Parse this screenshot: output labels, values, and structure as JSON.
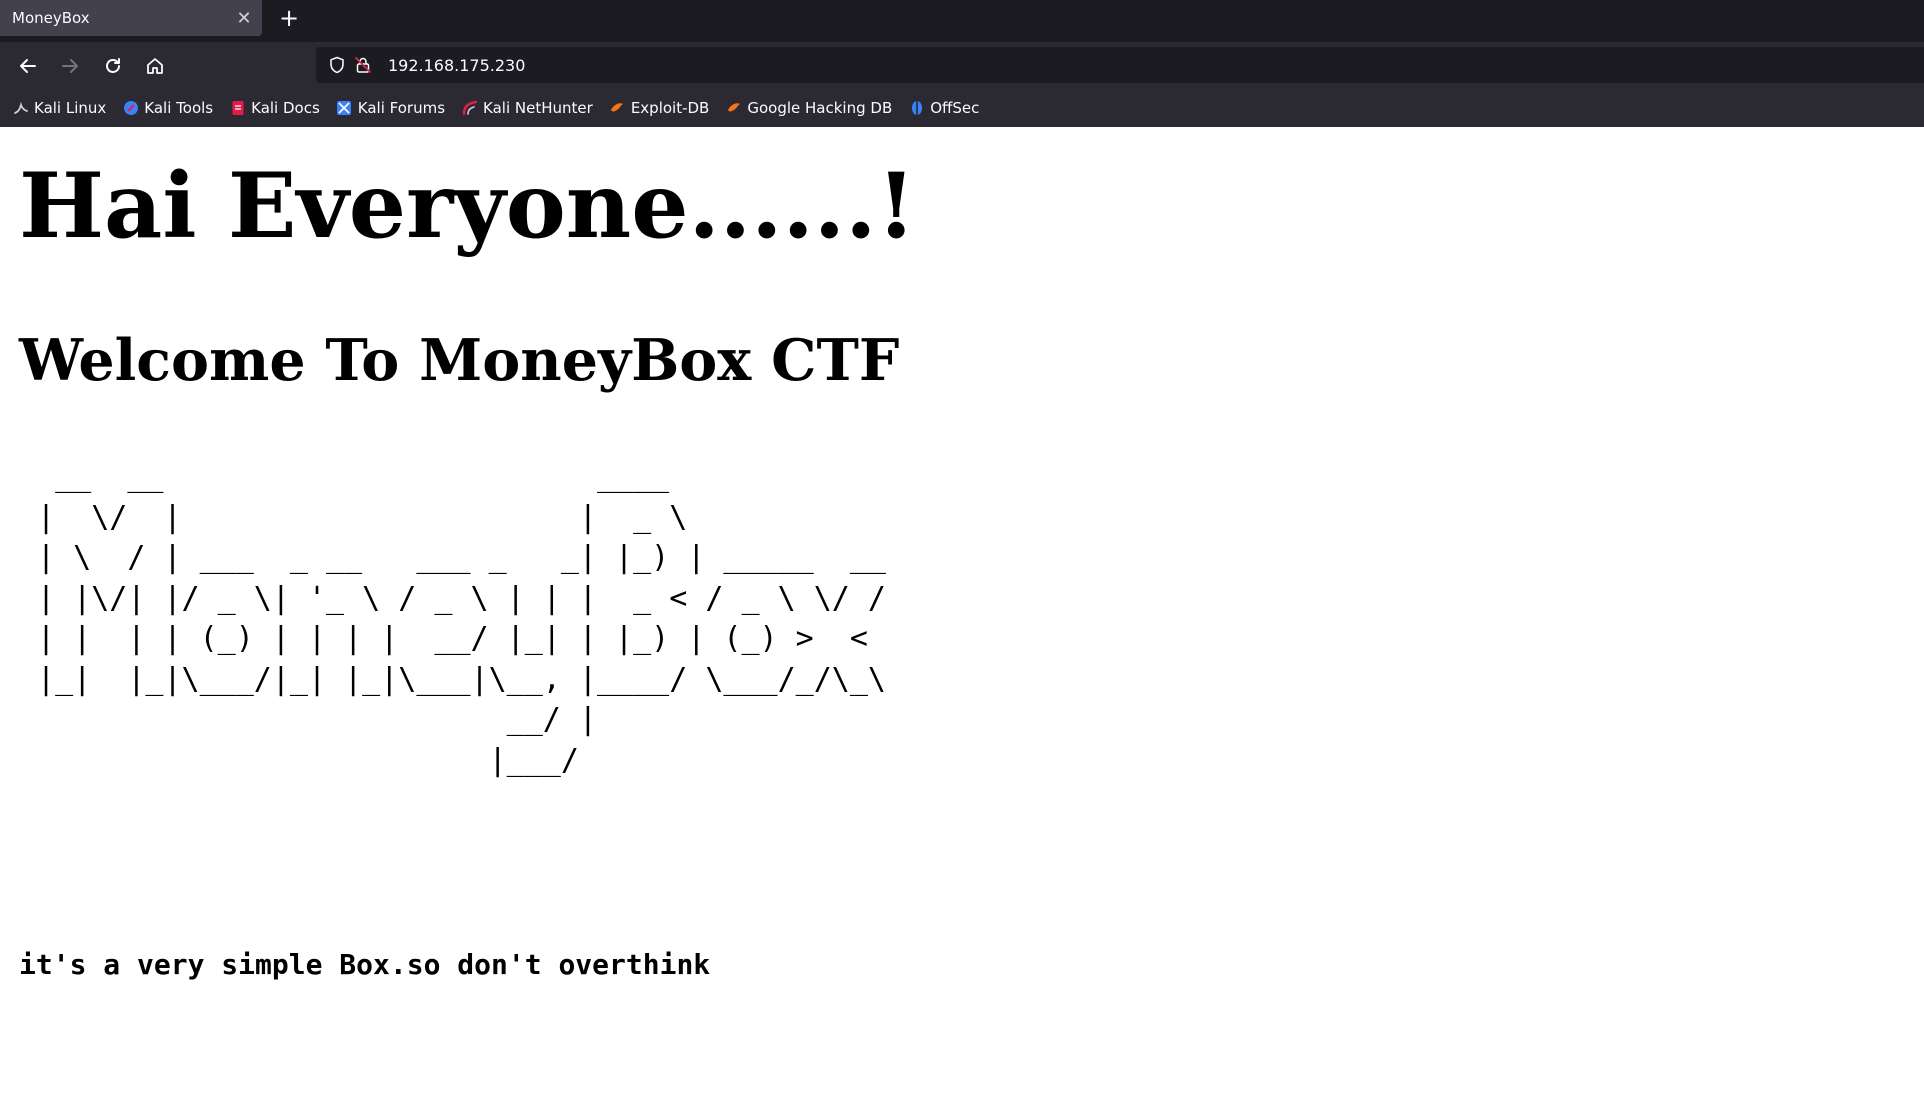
{
  "browser": {
    "tab": {
      "title": "MoneyBox",
      "close_symbol": "✕",
      "new_tab_symbol": "+"
    },
    "url": "192.168.175.230",
    "bookmarks": [
      {
        "label": "Kali Linux",
        "icon": "kali-dragon-icon",
        "color": "#cfcfd6"
      },
      {
        "label": "Kali Tools",
        "icon": "kali-tools-icon",
        "color": "#3b82f6"
      },
      {
        "label": "Kali Docs",
        "icon": "kali-docs-icon",
        "color": "#e11d48"
      },
      {
        "label": "Kali Forums",
        "icon": "kali-forums-icon",
        "color": "#3b82f6"
      },
      {
        "label": "Kali NetHunter",
        "icon": "kali-nethunter-icon",
        "color": "#e11d48"
      },
      {
        "label": "Exploit-DB",
        "icon": "exploit-db-icon",
        "color": "#f97316"
      },
      {
        "label": "Google Hacking DB",
        "icon": "google-hacking-db-icon",
        "color": "#f97316"
      },
      {
        "label": "OffSec",
        "icon": "offsec-icon",
        "color": "#3b82f6"
      }
    ]
  },
  "page": {
    "heading1": "Hai Everyone......!",
    "heading2": "Welcome To MoneyBox CTF",
    "ascii_art": "  __  __                        ____            \n |  \\/  |                      |  _ \\           \n | \\  / | ___  _ __   ___ _   _| |_) | _____  __\n | |\\/| |/ _ \\| '_ \\ / _ \\ | | |  _ < / _ \\ \\/ /\n | |  | | (_) | | | |  __/ |_| | |_) | (_) >  < \n |_|  |_|\\___/|_| |_|\\___|\\__, |____/ \\___/_/\\_\\\n                           __/ |                \n                          |___/                 ",
    "heading3": "it's a very simple Box.so don't overthink"
  }
}
